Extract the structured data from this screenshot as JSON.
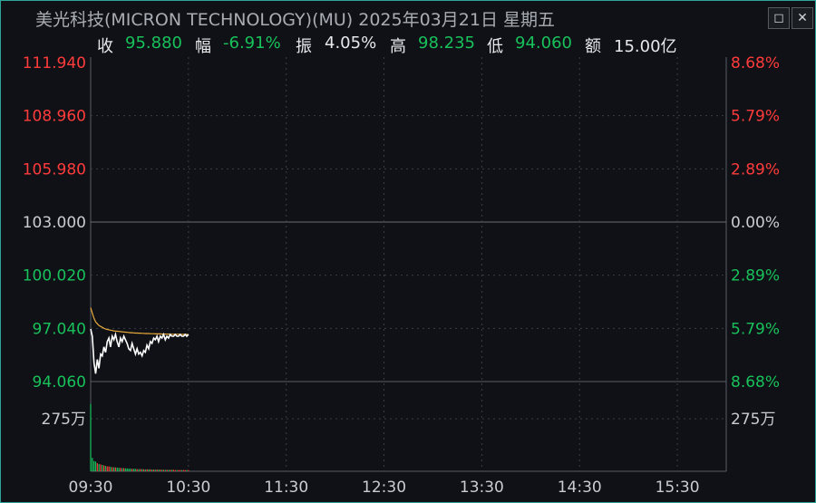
{
  "window": {
    "title": "美光科技(MICRON TECHNOLOGY)(MU) 2025年03月21日 星期五",
    "restore_icon": "◻",
    "close_icon": "✕"
  },
  "quote": {
    "close_label": "收",
    "close_value": "95.880",
    "change_label": "幅",
    "change_value": "-6.91%",
    "amplitude_label": "振",
    "amplitude_value": "4.05%",
    "high_label": "高",
    "high_value": "98.235",
    "low_label": "低",
    "low_value": "94.060",
    "turnover_label": "额",
    "turnover_value": "15.00亿"
  },
  "colors": {
    "up": "#ff3b3b",
    "down": "#19c15b",
    "neutral": "#c9ccd0",
    "price_line": "#ffffff",
    "avg_line": "#e8a93a",
    "grid": "#3a3e45"
  },
  "chart_data": {
    "type": "line",
    "prev_close": 103.0,
    "ylim": [
      94.06,
      111.94
    ],
    "price_ticks_left": [
      "111.940",
      "108.960",
      "105.980",
      "103.000",
      "100.020",
      "97.040",
      "94.060"
    ],
    "pct_ticks_right": [
      "8.68%",
      "5.79%",
      "2.89%",
      "0.00%",
      "2.89%",
      "5.79%",
      "8.68%"
    ],
    "volume_tick_left": "275万",
    "volume_tick_right": "275万",
    "time_ticks": [
      "09:30",
      "10:30",
      "11:30",
      "12:30",
      "13:30",
      "14:30",
      "15:30"
    ],
    "x_minutes_total": 390,
    "series": [
      {
        "values": [
          97.0,
          96.6,
          95.1,
          94.5,
          95.3,
          94.8,
          95.6,
          95.5,
          96.0,
          95.7,
          96.3,
          96.5,
          96.0,
          96.6,
          96.4,
          96.7,
          96.3,
          96.0,
          96.5,
          96.3,
          96.6,
          96.4,
          96.2,
          95.9,
          95.8,
          96.2,
          95.9,
          95.6,
          95.9,
          95.6,
          95.7,
          95.5,
          95.8,
          95.7,
          96.1,
          95.9,
          96.3,
          96.2,
          96.5,
          96.4,
          96.6,
          96.3,
          96.6,
          96.5,
          96.7,
          96.4,
          96.6,
          96.5,
          96.7,
          96.6,
          96.6,
          96.7,
          96.6,
          96.6,
          96.7,
          96.6,
          96.6,
          96.7,
          96.6,
          96.7
        ]
      },
      {
        "values": [
          98.2,
          97.9,
          97.6,
          97.4,
          97.3,
          97.2,
          97.15,
          97.1,
          97.05,
          97.0,
          96.98,
          96.96,
          96.94,
          96.92,
          96.9,
          96.89,
          96.88,
          96.87,
          96.86,
          96.85,
          96.84,
          96.83,
          96.82,
          96.81,
          96.8,
          96.8,
          96.79,
          96.78,
          96.78,
          96.77,
          96.77,
          96.76,
          96.76,
          96.75,
          96.75,
          96.75,
          96.74,
          96.74,
          96.74,
          96.73,
          96.73,
          96.73,
          96.73,
          96.72,
          96.72,
          96.72,
          96.72,
          96.72,
          96.71,
          96.71,
          96.71,
          96.71,
          96.71,
          96.71,
          96.7,
          96.7,
          96.7,
          96.7,
          96.7,
          96.7
        ]
      }
    ],
    "volume": [
      2.75,
      0.55,
      0.42,
      0.4,
      0.33,
      0.3,
      0.28,
      0.26,
      0.24,
      0.22,
      0.2,
      0.2,
      0.18,
      0.17,
      0.16,
      0.16,
      0.15,
      0.14,
      0.14,
      0.13,
      0.13,
      0.12,
      0.12,
      0.11,
      0.11,
      0.1,
      0.1,
      0.1,
      0.09,
      0.09,
      0.09,
      0.09,
      0.08,
      0.08,
      0.08,
      0.08,
      0.08,
      0.07,
      0.07,
      0.07,
      0.07,
      0.07,
      0.07,
      0.06,
      0.06,
      0.06,
      0.06,
      0.06,
      0.06,
      0.06,
      0.06,
      0.05,
      0.05,
      0.05,
      0.05,
      0.05,
      0.05,
      0.05,
      0.05,
      0.05
    ],
    "volume_ylim": [
      0,
      3.0
    ],
    "grid": true
  }
}
